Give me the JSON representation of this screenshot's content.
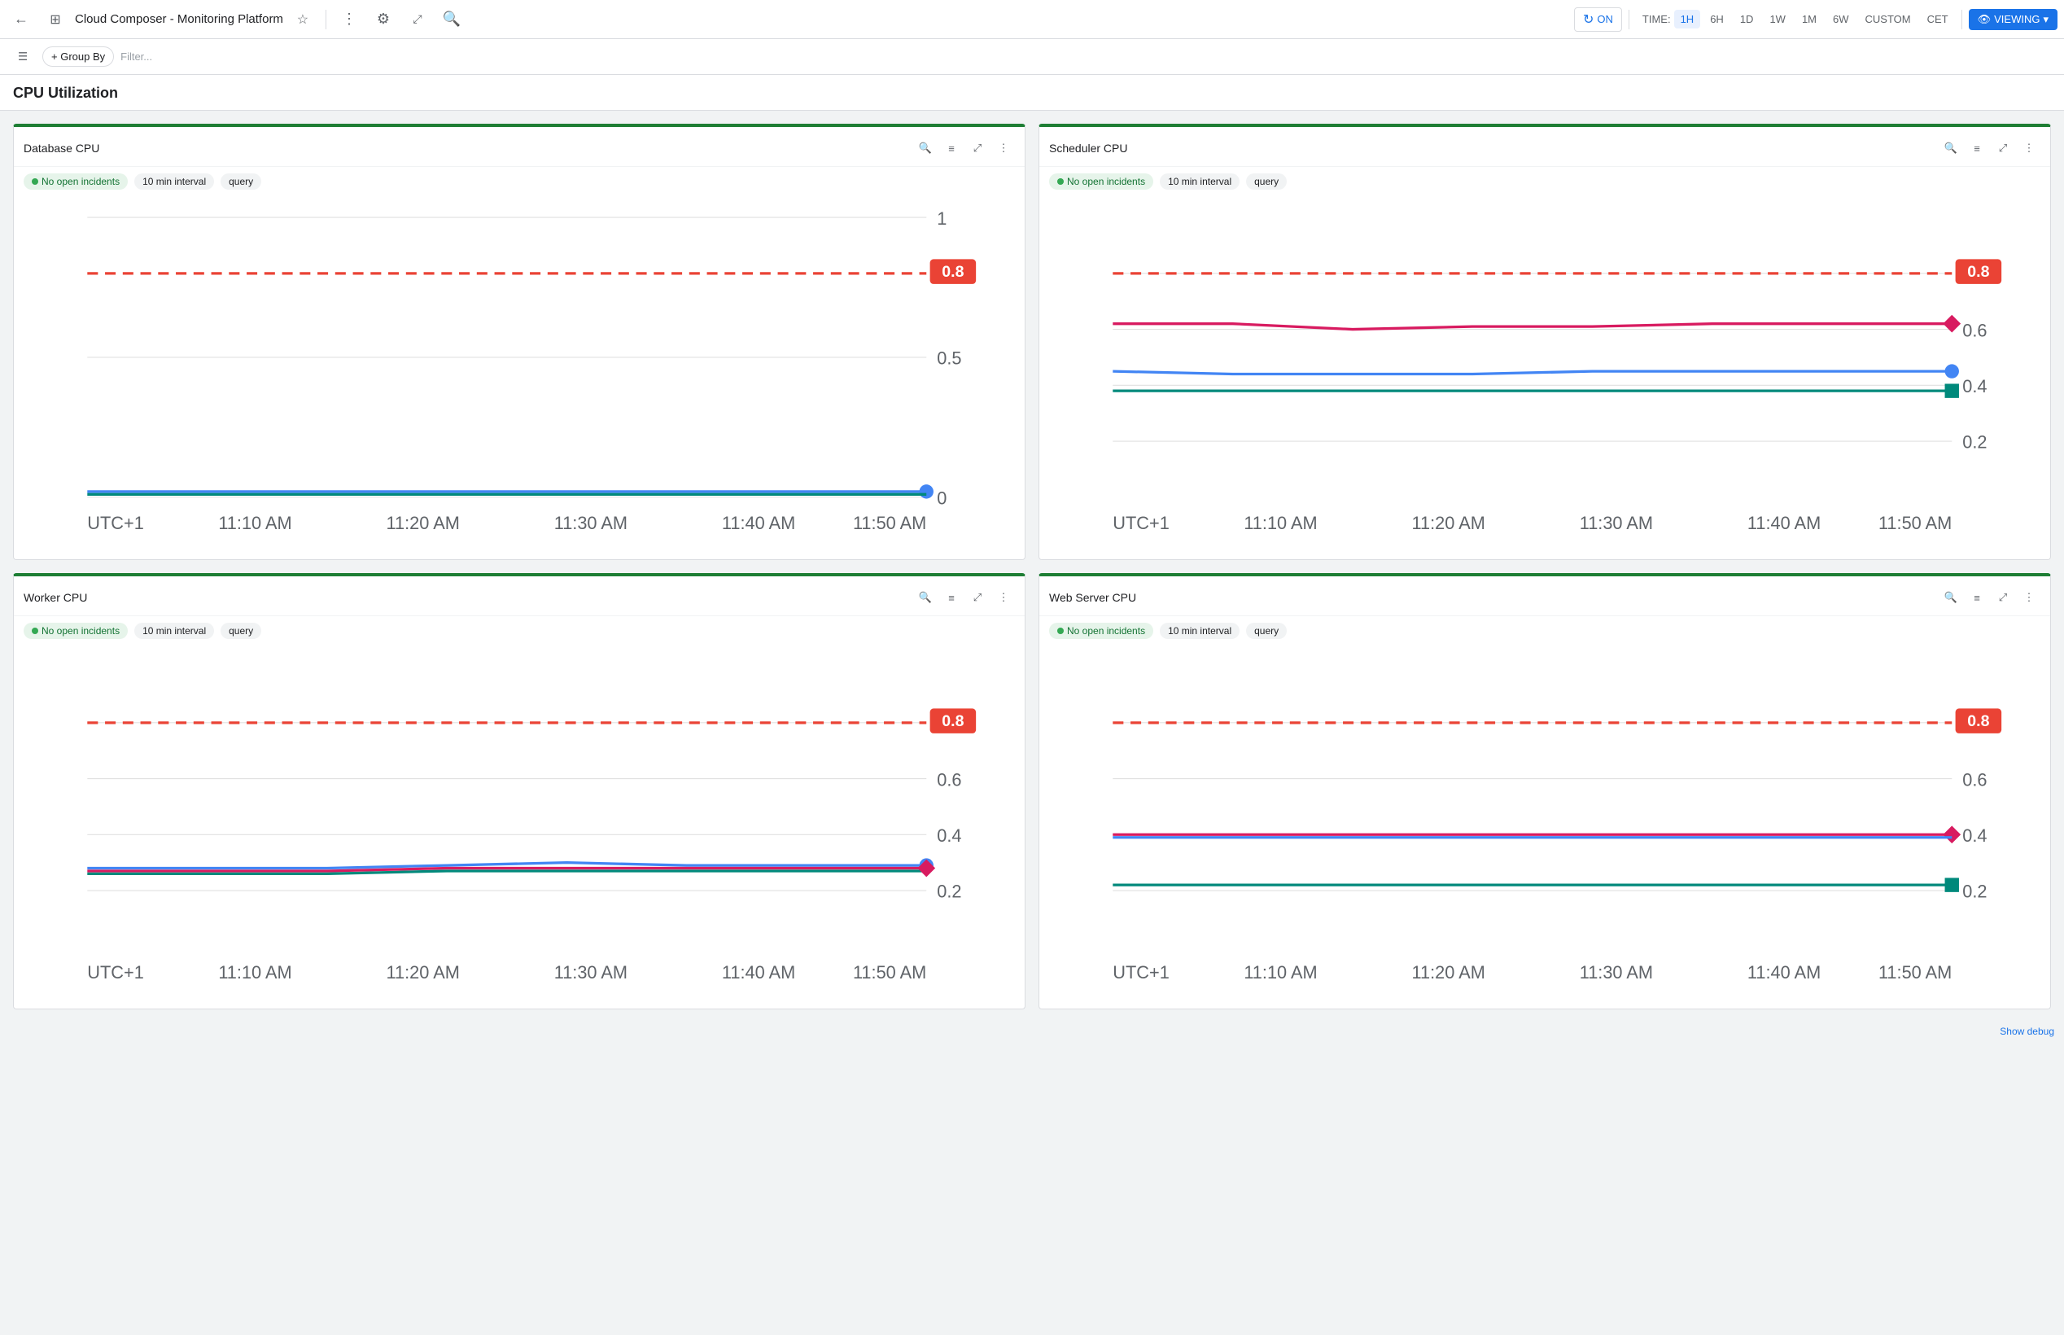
{
  "topnav": {
    "back_label": "←",
    "grid_icon": "⊞",
    "title": "Cloud Composer - Monitoring Platform",
    "star_icon": "☆",
    "more_icon": "⋮",
    "settings_icon": "⚙",
    "expand_icon": "⤢",
    "search_icon": "🔍",
    "refresh_icon": "↻",
    "on_label": "ON",
    "time_label": "TIME:",
    "time_options": [
      "1H",
      "6H",
      "1D",
      "1W",
      "1M",
      "6W",
      "CUSTOM",
      "CET"
    ],
    "active_time": "1H",
    "eye_icon": "👁",
    "viewing_label": "VIEWING",
    "viewing_chevron": "▾"
  },
  "filterbar": {
    "menu_icon": "☰",
    "group_by_label": "+ Group By",
    "filter_placeholder": "Filter..."
  },
  "page": {
    "section_title": "CPU Utilization"
  },
  "charts": [
    {
      "id": "database-cpu",
      "title": "Database CPU",
      "badge_label": "No open incidents",
      "interval_label": "10 min interval",
      "query_label": "query",
      "threshold": 0.8,
      "y_max": 1,
      "y_labels": [
        "1",
        "0.5",
        "0"
      ],
      "lines": [
        {
          "color": "blue",
          "values": [
            0.02,
            0.02,
            0.02,
            0.02,
            0.02,
            0.02,
            0.02,
            0.02
          ],
          "end_dot": true
        },
        {
          "color": "teal",
          "values": [
            0.01,
            0.01,
            0.01,
            0.01,
            0.01,
            0.01,
            0.01,
            0.01
          ],
          "end_dot": false
        }
      ],
      "x_labels": [
        "UTC+1",
        "11:10 AM",
        "11:20 AM",
        "11:30 AM",
        "11:40 AM",
        "11:50 AM"
      ]
    },
    {
      "id": "scheduler-cpu",
      "title": "Scheduler CPU",
      "badge_label": "No open incidents",
      "interval_label": "10 min interval",
      "query_label": "query",
      "threshold": 0.8,
      "y_max": 1,
      "y_labels": [
        "0.8",
        "0.6",
        "0.4",
        "0.2"
      ],
      "lines": [
        {
          "color": "pink",
          "values": [
            0.62,
            0.62,
            0.6,
            0.61,
            0.61,
            0.62,
            0.62,
            0.62
          ],
          "end_dot": true
        },
        {
          "color": "blue",
          "values": [
            0.45,
            0.44,
            0.44,
            0.44,
            0.45,
            0.45,
            0.45,
            0.45
          ],
          "end_dot": true
        },
        {
          "color": "teal",
          "values": [
            0.38,
            0.38,
            0.38,
            0.38,
            0.38,
            0.38,
            0.38,
            0.38
          ],
          "end_dot": true
        }
      ],
      "x_labels": [
        "UTC+1",
        "11:10 AM",
        "11:20 AM",
        "11:30 AM",
        "11:40 AM",
        "11:50 AM"
      ]
    },
    {
      "id": "worker-cpu",
      "title": "Worker CPU",
      "badge_label": "No open incidents",
      "interval_label": "10 min interval",
      "query_label": "query",
      "threshold": 0.8,
      "y_max": 1,
      "y_labels": [
        "0.8",
        "0.6",
        "0.4",
        "0.2"
      ],
      "lines": [
        {
          "color": "blue",
          "values": [
            0.28,
            0.28,
            0.28,
            0.29,
            0.3,
            0.29,
            0.29,
            0.29
          ],
          "end_dot": true
        },
        {
          "color": "teal",
          "values": [
            0.26,
            0.26,
            0.26,
            0.27,
            0.27,
            0.27,
            0.27,
            0.27
          ],
          "end_dot": false
        },
        {
          "color": "pink",
          "values": [
            0.27,
            0.27,
            0.27,
            0.28,
            0.28,
            0.28,
            0.28,
            0.28
          ],
          "end_dot": true
        }
      ],
      "x_labels": [
        "UTC+1",
        "11:10 AM",
        "11:20 AM",
        "11:30 AM",
        "11:40 AM",
        "11:50 AM"
      ]
    },
    {
      "id": "web-server-cpu",
      "title": "Web Server CPU",
      "badge_label": "No open incidents",
      "interval_label": "10 min interval",
      "query_label": "query",
      "threshold": 0.8,
      "y_max": 1,
      "y_labels": [
        "0.8",
        "0.6",
        "0.4",
        "0.2"
      ],
      "lines": [
        {
          "color": "pink",
          "values": [
            0.4,
            0.4,
            0.4,
            0.4,
            0.4,
            0.4,
            0.4,
            0.4
          ],
          "end_dot": true
        },
        {
          "color": "blue",
          "values": [
            0.39,
            0.39,
            0.39,
            0.39,
            0.39,
            0.39,
            0.39,
            0.39
          ],
          "end_dot": false
        },
        {
          "color": "teal",
          "values": [
            0.22,
            0.22,
            0.22,
            0.22,
            0.22,
            0.22,
            0.22,
            0.22
          ],
          "end_dot": true
        }
      ],
      "x_labels": [
        "UTC+1",
        "11:10 AM",
        "11:20 AM",
        "11:30 AM",
        "11:40 AM",
        "11:50 AM"
      ]
    }
  ],
  "show_debug_label": "Show debug"
}
